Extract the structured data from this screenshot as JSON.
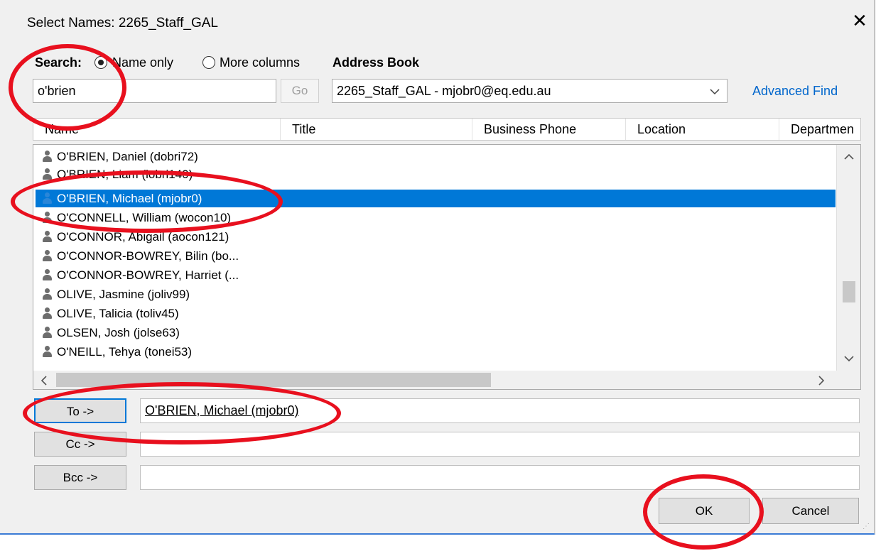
{
  "window": {
    "title": "Select Names: 2265_Staff_GAL",
    "close_glyph": "✕"
  },
  "search": {
    "label": "Search:",
    "option_name_only": "Name only",
    "option_more_columns": "More columns",
    "selected_option": "Name only",
    "query": "o'brien",
    "go_label": "Go"
  },
  "address_book": {
    "label": "Address Book",
    "selected": "2265_Staff_GAL - mjobr0@eq.edu.au",
    "advanced_find_label": "Advanced Find"
  },
  "columns": [
    "Name",
    "Title",
    "Business Phone",
    "Location",
    "Departmen"
  ],
  "names": [
    "O'BRIEN, Daniel (dobri72)",
    "O'BRIEN, Liam (lobri140)",
    "O'BRIEN, Michael (mjobr0)",
    "O'CONNELL, William (wocon10)",
    "O'CONNOR, Abigail (aocon121)",
    "O'CONNOR-BOWREY, Bilin (bo...",
    "O'CONNOR-BOWREY, Harriet (...",
    "OLIVE, Jasmine (joliv99)",
    "OLIVE, Talicia (toliv45)",
    "OLSEN, Josh (jolse63)",
    "O'NEILL, Tehya (tonei53)"
  ],
  "selected_name": "O'BRIEN, Michael (mjobr0)",
  "recipients": {
    "to_label": "To ->",
    "to_value": "O'BRIEN, Michael (mjobr0)",
    "cc_label": "Cc ->",
    "cc_value": "",
    "bcc_label": "Bcc ->",
    "bcc_value": ""
  },
  "buttons": {
    "ok": "OK",
    "cancel": "Cancel"
  },
  "colors": {
    "selection": "#0078d7",
    "annotation": "#e8101e",
    "link": "#0066cc"
  }
}
